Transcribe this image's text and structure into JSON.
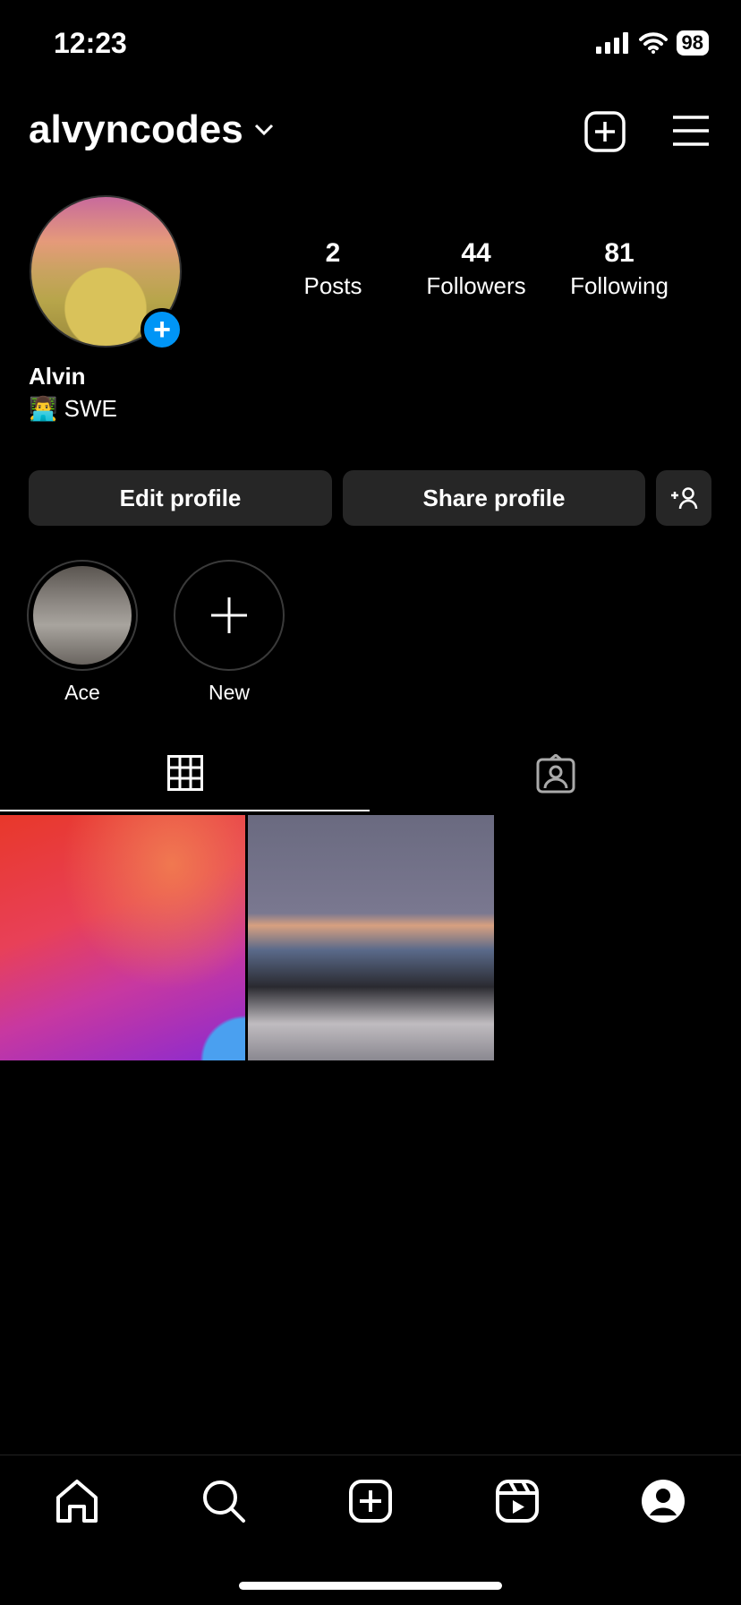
{
  "status_bar": {
    "time": "12:23",
    "battery": "98"
  },
  "header": {
    "username": "alvyncodes"
  },
  "profile": {
    "name": "Alvin",
    "bio_emoji": "👨‍💻",
    "bio": "SWE"
  },
  "stats": [
    {
      "value": "2",
      "label": "Posts"
    },
    {
      "value": "44",
      "label": "Followers"
    },
    {
      "value": "81",
      "label": "Following"
    }
  ],
  "buttons": {
    "edit": "Edit profile",
    "share": "Share profile"
  },
  "highlights": [
    {
      "label": "Ace"
    },
    {
      "label": "New"
    }
  ],
  "colors": {
    "accent": "#0095f6",
    "button_bg": "#262626"
  }
}
